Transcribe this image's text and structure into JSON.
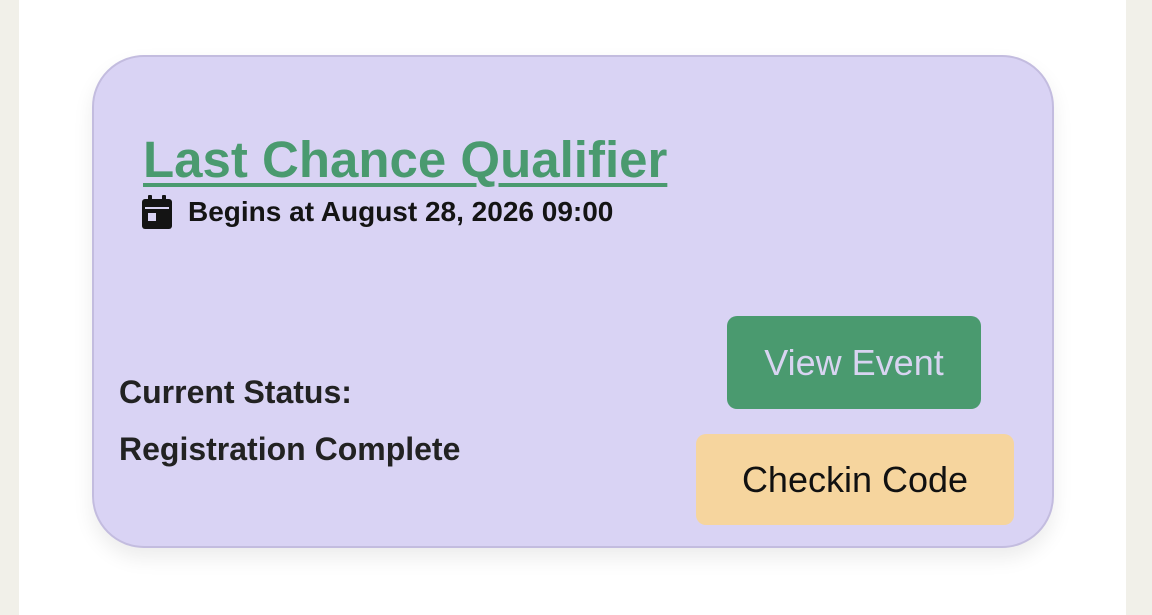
{
  "event": {
    "title": "Last Chance Qualifier",
    "begins": "Begins at August 28, 2026 09:00",
    "icon": "calendar-icon",
    "status_label": "Current Status:",
    "status_value": "Registration Complete",
    "view_label": "View Event",
    "checkin_label": "Checkin Code"
  },
  "colors": {
    "card_background": "#d9d3f4",
    "title": "#4a9a6f",
    "view_button": "#4a9a6f",
    "checkin_button": "#f6d59e",
    "page_background": "#f1f0e9"
  }
}
